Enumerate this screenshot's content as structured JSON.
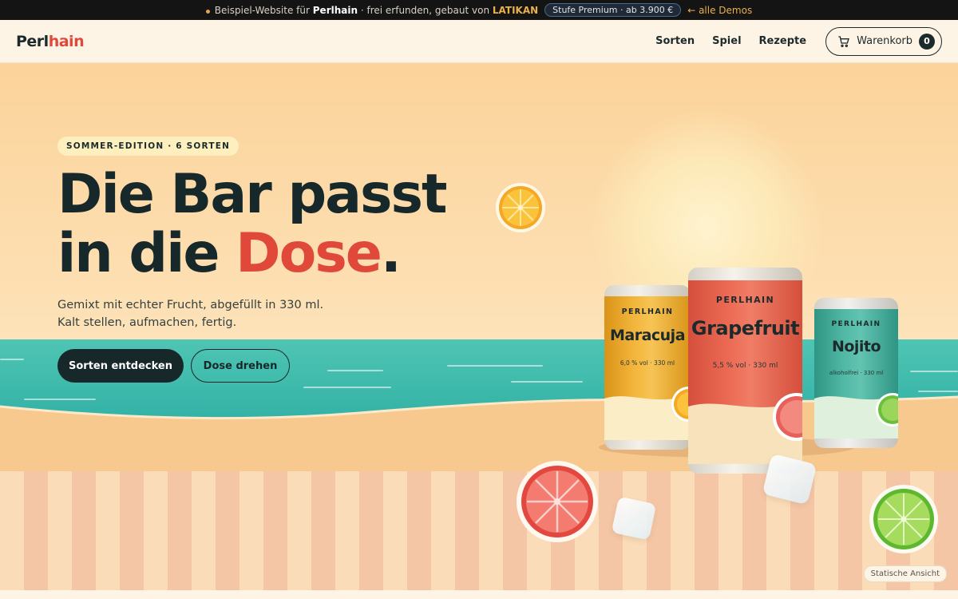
{
  "topbar": {
    "prefix": "Beispiel-Website für",
    "brand": "Perlhain",
    "middle": "· frei erfunden, gebaut von",
    "maker": "LATIKAN",
    "pill": "Stufe Premium · ab 3.900 €",
    "back": "← alle Demos"
  },
  "header": {
    "logo_part1": "Perl",
    "logo_part2": "hain",
    "nav": [
      "Sorten",
      "Spiel",
      "Rezepte"
    ],
    "cart_label": "Warenkorb",
    "cart_count": "0"
  },
  "hero": {
    "badge": "SOMMER-EDITION · 6 SORTEN",
    "headline_line1": "Die Bar passt",
    "headline_line2_a": "in die ",
    "headline_line2_red": "Dose",
    "headline_line2_b": ".",
    "sub": "Gemixt mit echter Frucht, abgefüllt in 330 ml. Kalt stellen, aufmachen, fertig.",
    "btn_primary": "Sorten entdecken",
    "btn_secondary": "Dose drehen",
    "static_view": "Statische Ansicht"
  },
  "cans": [
    {
      "brand": "PERLHAIN",
      "flavor": "Maracuja",
      "info": "6,0 % vol · 330 ml",
      "color": "#f1b33a",
      "cream": "#fbeec6"
    },
    {
      "brand": "PERLHAIN",
      "flavor": "Grapefruit",
      "info": "5,5 % vol · 330 ml",
      "color": "#ea6550",
      "cream": "#f8e2bc"
    },
    {
      "brand": "PERLHAIN",
      "flavor": "Nojito",
      "info": "alkoholfrei · 330 ml",
      "color": "#4db3a1",
      "cream": "#dff1dc"
    }
  ],
  "colors": {
    "dark": "#17282a",
    "accent_red": "#e0493a",
    "sea": "#30b0a4",
    "sand": "#f7c98f"
  },
  "icons": {
    "cart": "cart-icon",
    "orange_slice": "orange-slice-icon",
    "grapefruit_slice": "grapefruit-slice-icon",
    "lime_slice": "lime-slice-icon",
    "ice_cube": "ice-cube-icon"
  }
}
